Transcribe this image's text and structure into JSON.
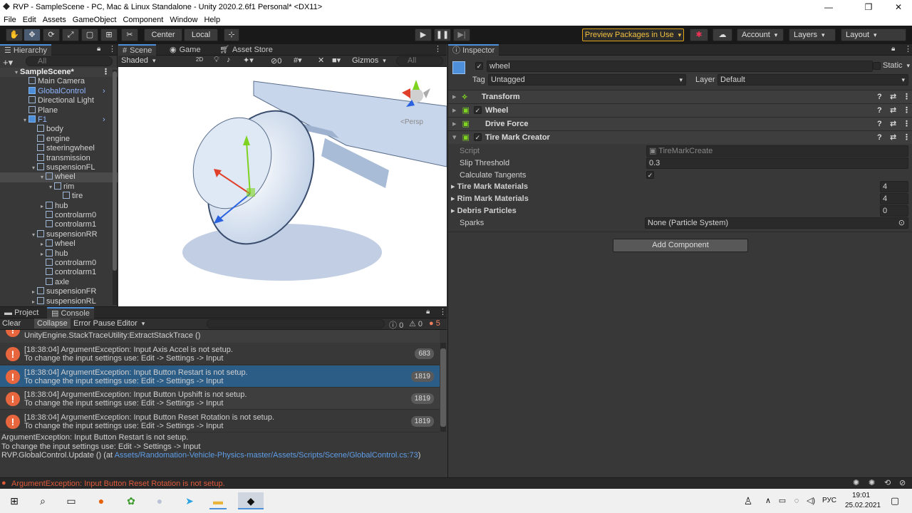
{
  "window": {
    "title": "RVP - SampleScene - PC, Mac & Linux Standalone - Unity 2020.2.6f1 Personal* <DX11>"
  },
  "menu": [
    "File",
    "Edit",
    "Assets",
    "GameObject",
    "Component",
    "Window",
    "Help"
  ],
  "toolbar": {
    "pivot": "Center",
    "space": "Local",
    "preview_packages": "Preview Packages in Use",
    "account": "Account",
    "layers": "Layers",
    "layout": "Layout"
  },
  "hierarchy": {
    "tab": "Hierarchy",
    "search_placeholder": "All",
    "items": [
      {
        "label": "SampleScene*",
        "indent": 0
      },
      {
        "label": "Main Camera",
        "indent": 1
      },
      {
        "label": "GlobalControl",
        "indent": 1
      },
      {
        "label": "Directional Light",
        "indent": 1
      },
      {
        "label": "Plane",
        "indent": 1
      },
      {
        "label": "F1",
        "indent": 1
      },
      {
        "label": "body",
        "indent": 2
      },
      {
        "label": "engine",
        "indent": 2
      },
      {
        "label": "steeringwheel",
        "indent": 2
      },
      {
        "label": "transmission",
        "indent": 2
      },
      {
        "label": "suspensionFL",
        "indent": 2
      },
      {
        "label": "wheel",
        "indent": 3
      },
      {
        "label": "rim",
        "indent": 4
      },
      {
        "label": "tire",
        "indent": 5
      },
      {
        "label": "hub",
        "indent": 3
      },
      {
        "label": "controlarm0",
        "indent": 3
      },
      {
        "label": "controlarm1",
        "indent": 3
      },
      {
        "label": "suspensionRR",
        "indent": 2
      },
      {
        "label": "wheel",
        "indent": 3
      },
      {
        "label": "hub",
        "indent": 3
      },
      {
        "label": "controlarm0",
        "indent": 3
      },
      {
        "label": "controlarm1",
        "indent": 3
      },
      {
        "label": "axle",
        "indent": 3
      },
      {
        "label": "suspensionFR",
        "indent": 2
      },
      {
        "label": "suspensionRL",
        "indent": 2
      }
    ]
  },
  "scene": {
    "tabs": [
      "Scene",
      "Game",
      "Asset Store"
    ],
    "shading": "Shaded",
    "mode2d": "2D",
    "gizmos": "Gizmos",
    "hidden_count": "0",
    "search_placeholder": "All",
    "persp": "<Persp"
  },
  "inspector": {
    "tab": "Inspector",
    "object_name": "wheel",
    "static": "Static",
    "tag_label": "Tag",
    "tag_value": "Untagged",
    "layer_label": "Layer",
    "layer_value": "Default",
    "components": [
      "Transform",
      "Wheel",
      "Drive Force",
      "Tire Mark Creator"
    ],
    "props": {
      "script_label": "Script",
      "script_value": "TireMarkCreate",
      "slip_label": "Slip Threshold",
      "slip_value": "0.3",
      "tangents_label": "Calculate Tangents",
      "tire_label": "Tire Mark Materials",
      "tire_value": "4",
      "rim_label": "Rim Mark Materials",
      "rim_value": "4",
      "debris_label": "Debris Particles",
      "debris_value": "0",
      "sparks_label": "Sparks",
      "sparks_value": "None (Particle System)"
    },
    "add_component": "Add Component"
  },
  "console": {
    "tabs": [
      "Project",
      "Console"
    ],
    "buttons": [
      "Clear",
      "Collapse",
      "Error Pause",
      "Editor"
    ],
    "counts": {
      "log": "0",
      "warn": "0",
      "error": "5"
    },
    "partial_top": "UnityEngine.StackTraceUtility:ExtractStackTrace ()",
    "entries": [
      {
        "line1": "[18:38:04] ArgumentException: Input Axis Accel is not setup.",
        "line2": " To change the input settings use: Edit -> Settings -> Input",
        "count": "683"
      },
      {
        "line1": "[18:38:04] ArgumentException: Input Button Restart is not setup.",
        "line2": " To change the input settings use: Edit -> Settings -> Input",
        "count": "1819"
      },
      {
        "line1": "[18:38:04] ArgumentException: Input Button Upshift is not setup.",
        "line2": " To change the input settings use: Edit -> Settings -> Input",
        "count": "1819"
      },
      {
        "line1": "[18:38:04] ArgumentException: Input Button Reset Rotation is not setup.",
        "line2": " To change the input settings use: Edit -> Settings -> Input",
        "count": "1819"
      }
    ],
    "detail1": "ArgumentException: Input Button Restart is not setup.",
    "detail2": " To change the input settings use: Edit -> Settings -> Input",
    "detail3_prefix": "RVP.GlobalControl.Update () (at ",
    "detail3_link": "Assets/Randomation-Vehicle-Physics-master/Assets/Scripts/Scene/GlobalControl.cs:73",
    "detail3_suffix": ")"
  },
  "status": {
    "message": "ArgumentException: Input Button Reset Rotation is not setup."
  },
  "taskbar": {
    "time": "19:01",
    "date": "25.02.2021",
    "lang": "РУС"
  },
  "colors": {
    "accent": "#4d8fd8",
    "error": "#e8663d",
    "selection": "#2c5d87",
    "preview_border": "#e2a516"
  }
}
